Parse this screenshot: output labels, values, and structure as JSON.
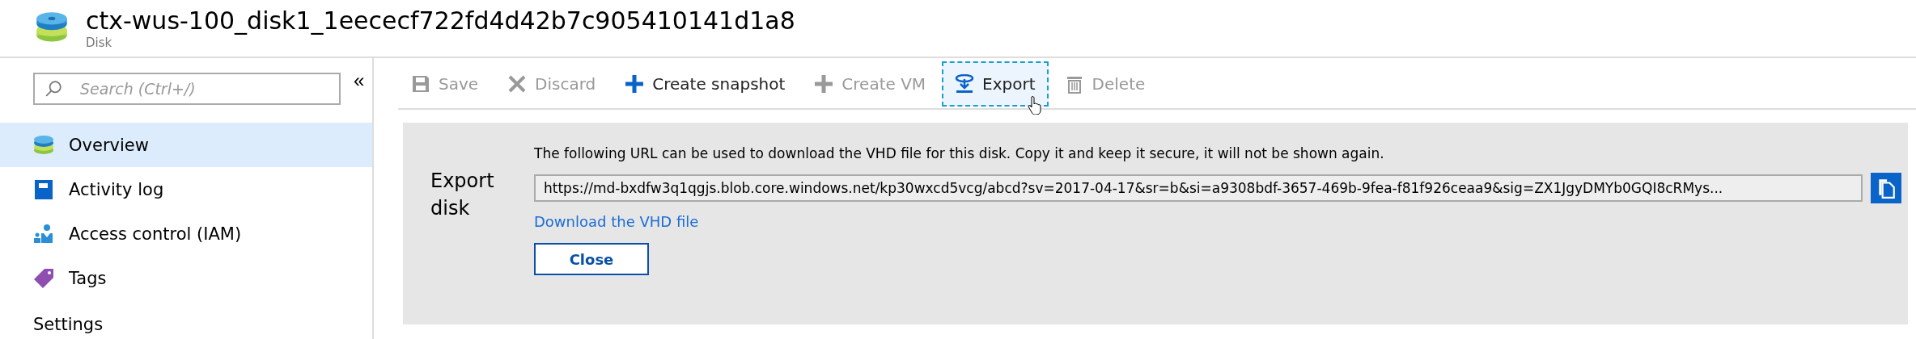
{
  "header": {
    "title": "ctx-wus-100_disk1_1eececf722fd4d42b7c905410141d1a8",
    "subtitle": "Disk"
  },
  "sidebar": {
    "search": {
      "placeholder": "Search (Ctrl+/)"
    },
    "collapse": "«",
    "items": [
      {
        "label": "Overview",
        "kind": "disk",
        "selected": true
      },
      {
        "label": "Activity log",
        "kind": "log",
        "selected": false
      },
      {
        "label": "Access control (IAM)",
        "kind": "iam",
        "selected": false
      },
      {
        "label": "Tags",
        "kind": "tag",
        "selected": false
      }
    ],
    "section": "Settings"
  },
  "toolbar": [
    {
      "label": "Save",
      "kind": "save",
      "disabled": true,
      "focused": false
    },
    {
      "label": "Discard",
      "kind": "discard",
      "disabled": true,
      "focused": false
    },
    {
      "label": "Create snapshot",
      "kind": "plus",
      "disabled": false,
      "focused": false
    },
    {
      "label": "Create VM",
      "kind": "plus",
      "disabled": true,
      "focused": false
    },
    {
      "label": "Export",
      "kind": "export",
      "disabled": false,
      "focused": true
    },
    {
      "label": "Delete",
      "kind": "delete",
      "disabled": true,
      "focused": false
    }
  ],
  "export_panel": {
    "heading": "Export disk",
    "message": "The following URL can be used to download the VHD file for this disk. Copy it and keep it secure, it will not be shown again.",
    "url": "https://md-bxdfw3q1qgjs.blob.core.windows.net/kp30wxcd5vcg/abcd?sv=2017-04-17&sr=b&si=a9308bdf-3657-469b-9fea-f81f926ceaa9&sig=ZX1JgyDMYb0GQI8cRMys...",
    "link": "Download the VHD file",
    "button": "Close"
  }
}
